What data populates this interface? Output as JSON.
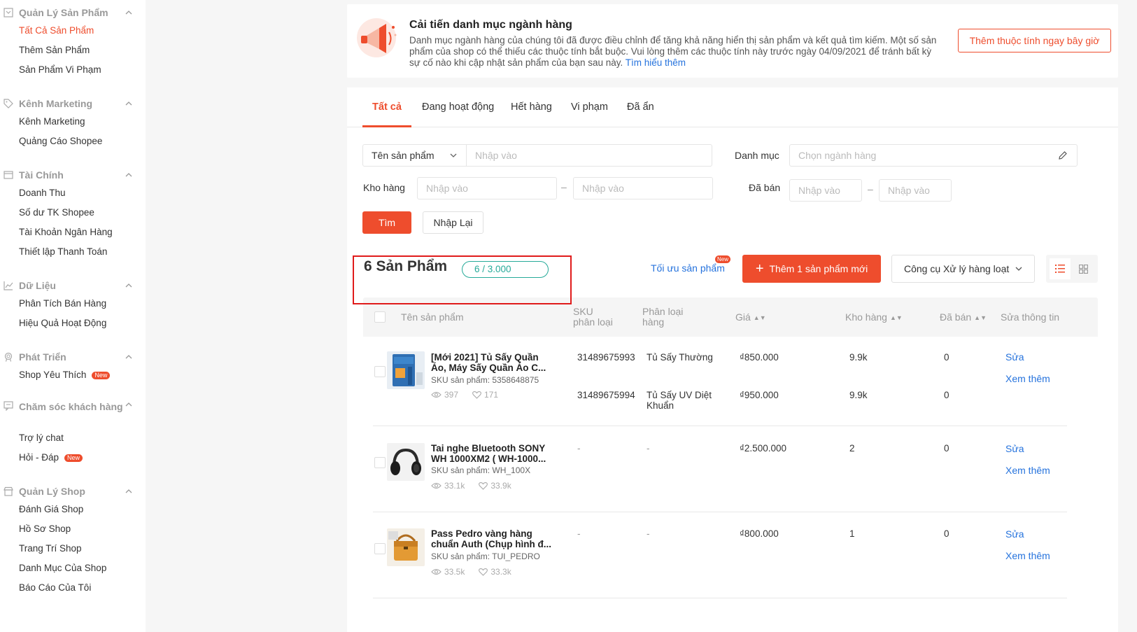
{
  "sidebar": {
    "sections": [
      {
        "title": "Quản Lý Sản Phẩm",
        "items": [
          "Tất Cả Sản Phẩm",
          "Thêm Sản Phẩm",
          "Sản Phẩm Vi Phạm"
        ]
      },
      {
        "title": "Kênh Marketing",
        "items": [
          "Kênh Marketing",
          "Quảng Cáo Shopee"
        ]
      },
      {
        "title": "Tài Chính",
        "items": [
          "Doanh Thu",
          "Số dư TK Shopee",
          "Tài Khoản Ngân Hàng",
          "Thiết lập Thanh Toán"
        ]
      },
      {
        "title": "Dữ Liệu",
        "items": [
          "Phân Tích Bán Hàng",
          "Hiệu Quả Hoạt Động"
        ]
      },
      {
        "title": "Phát Triển",
        "items": [
          "Shop Yêu Thích"
        ]
      },
      {
        "title": "Chăm sóc khách hàng",
        "items": [
          "Trợ lý chat",
          "Hỏi - Đáp"
        ]
      },
      {
        "title": "Quản Lý Shop",
        "items": [
          "Đánh Giá Shop",
          "Hồ Sơ Shop",
          "Trang Trí Shop",
          "Danh Mục Của Shop",
          "Báo Cáo Của Tôi"
        ]
      }
    ],
    "new_badge": "New"
  },
  "banner": {
    "title": "Cải tiến danh mục ngành hàng",
    "text": "Danh mục ngành hàng của chúng tôi đã được điều chỉnh để tăng khả năng hiển thị sản phẩm và kết quả tìm kiếm. Một số sản phẩm của shop có thể thiếu các thuộc tính bắt buộc. Vui lòng thêm các thuộc tính này trước ngày 04/09/2021 để tránh bất kỳ sự cố nào khi cập nhật sản phẩm của bạn sau này.",
    "link": "Tìm hiểu thêm",
    "button": "Thêm thuộc tính ngay bây giờ"
  },
  "tabs": [
    "Tất cả",
    "Đang hoạt động",
    "Hết hàng",
    "Vi phạm",
    "Đã ẩn"
  ],
  "filters": {
    "name_select": "Tên sản phẩm",
    "placeholder": "Nhập vào",
    "category_label": "Danh mục",
    "category_placeholder": "Chọn ngành hàng",
    "stock_label": "Kho hàng",
    "sold_label": "Đã bán",
    "search_btn": "Tìm",
    "reset_btn": "Nhập Lại",
    "range_sep": "–"
  },
  "summary": {
    "count_title": "6 Sản Phẩm",
    "quota": "6 / 3.000",
    "optimize": "Tối ưu sản phẩm",
    "add_product": "Thêm 1 sản phẩm mới",
    "bulk_tools": "Công cụ Xử lý hàng loạt"
  },
  "table": {
    "headers": {
      "name": "Tên sản phẩm",
      "sku": "SKU phân loại",
      "variant": "Phân loại hàng",
      "price": "Giá",
      "stock": "Kho hàng",
      "sold": "Đã bán",
      "edit": "Sửa thông tin"
    },
    "actions": {
      "edit": "Sửa",
      "more": "Xem thêm"
    },
    "rows": [
      {
        "name": "[Mới 2021] Tủ Sấy Quần Áo, Máy Sấy Quần Áo C...",
        "sku": "SKU sản phẩm: 5358648875",
        "views": "397",
        "likes": "171",
        "variants": [
          {
            "sku": "31489675993",
            "variant": "Tủ Sấy Thường",
            "price": "₫850.000",
            "stock": "9.9k",
            "sold": "0"
          },
          {
            "sku": "31489675994",
            "variant": "Tủ Sấy UV Diệt Khuẩn",
            "price": "₫950.000",
            "stock": "9.9k",
            "sold": "0"
          }
        ]
      },
      {
        "name": "Tai nghe Bluetooth SONY WH 1000XM2 ( WH-1000...",
        "sku": "SKU sản phẩm: WH_100X",
        "views": "33.1k",
        "likes": "33.9k",
        "variants": [
          {
            "sku": "-",
            "variant": "-",
            "price": "₫2.500.000",
            "stock": "2",
            "sold": "0"
          }
        ]
      },
      {
        "name": "Pass Pedro vàng hàng chuẩn Auth (Chụp hình đ...",
        "sku": "SKU sản phẩm: TUI_PEDRO",
        "views": "33.5k",
        "likes": "33.3k",
        "variants": [
          {
            "sku": "-",
            "variant": "-",
            "price": "₫800.000",
            "stock": "1",
            "sold": "0"
          }
        ]
      }
    ]
  },
  "colors": {
    "accent": "#ee4d2d",
    "link": "#2673dd",
    "teal": "#26aa99",
    "highlight": "#e01b1b"
  }
}
